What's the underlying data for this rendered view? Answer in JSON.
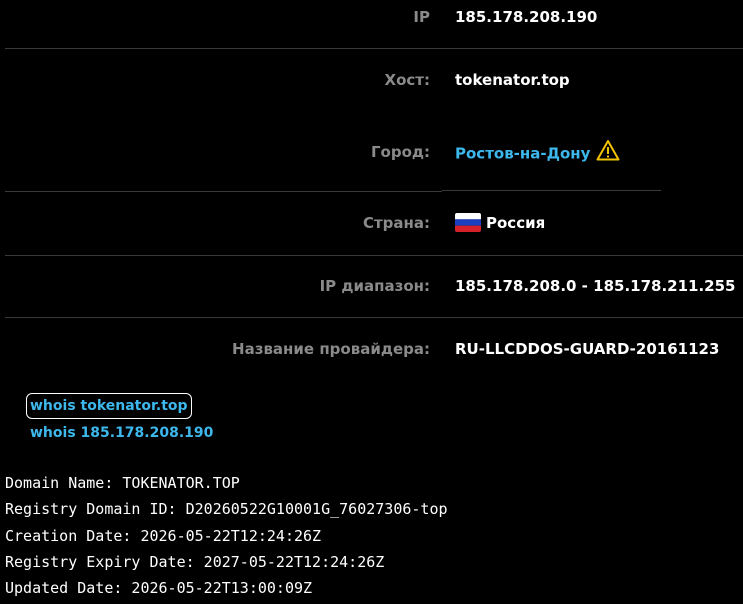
{
  "info": {
    "ip": {
      "label": "IP",
      "value": "185.178.208.190"
    },
    "host": {
      "label": "Хост:",
      "value": "tokenator.top"
    },
    "city": {
      "label": "Город:",
      "value": "Ростов-на-Дону",
      "icon": "warning-icon"
    },
    "country": {
      "label": "Страна:",
      "value": "Россия",
      "icon": "russia-flag-icon"
    },
    "ip_range": {
      "label": "IP диапазон:",
      "value": "185.178.208.0 - 185.178.211.255"
    },
    "provider": {
      "label": "Название провайдера:",
      "value": "RU-LLCDDOS-GUARD-20161123"
    }
  },
  "links": {
    "whois_domain": "whois tokenator.top",
    "whois_ip": "whois 185.178.208.190"
  },
  "whois": [
    "Domain Name: TOKENATOR.TOP",
    "Registry Domain ID: D20260522G10001G_76027306-top",
    "Creation Date: 2026-05-22T12:24:26Z",
    "Registry Expiry Date: 2027-05-22T12:24:26Z",
    "Updated Date: 2026-05-22T13:00:09Z"
  ],
  "colors": {
    "background": "#000000",
    "label": "#8a8a8a",
    "value": "#ffffff",
    "link": "#3db8ec",
    "warning": "#f2c200",
    "divider": "#3a3a3a"
  }
}
